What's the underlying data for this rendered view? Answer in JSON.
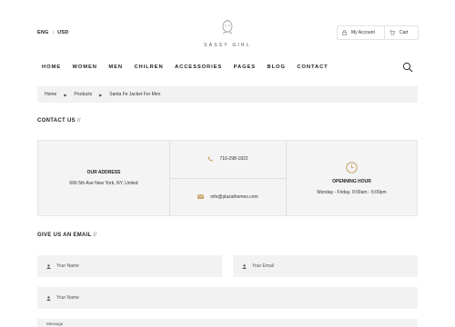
{
  "topbar": {
    "language": "ENG",
    "currency": "USD"
  },
  "logo": {
    "text": "SASSY GIRL"
  },
  "account": {
    "my_account": "My Account",
    "cart": "Cart"
  },
  "nav": {
    "items": [
      "HOME",
      "WOMEN",
      "MEN",
      "CHILREN",
      "ACCESSORIES",
      "PAGES",
      "BLOG",
      "CONTACT"
    ]
  },
  "breadcrumb": {
    "items": [
      "Home",
      "Products",
      "Santa Fe Jacket For Men"
    ]
  },
  "contact": {
    "heading": "CONTACT US",
    "heading_slash": "//",
    "address_label": "OUR ADDRESS",
    "address_value": "666 5th Ave New York, NY, United",
    "phone": "716-298-1822",
    "email": "info@plazathemes.com",
    "hours_label": "OPENNING HOUR",
    "hours_value": "Monday - Friday. 9:00am - 5:00pm"
  },
  "form": {
    "heading": "GIVE US AN EMAIL",
    "heading_slash": "//",
    "name_placeholder": "Your Name",
    "email_placeholder": "Your Email",
    "name2_placeholder": "Your Name",
    "message_placeholder": "Message"
  },
  "colors": {
    "accent": "#c9a96e",
    "panel": "#f4f4f4"
  }
}
